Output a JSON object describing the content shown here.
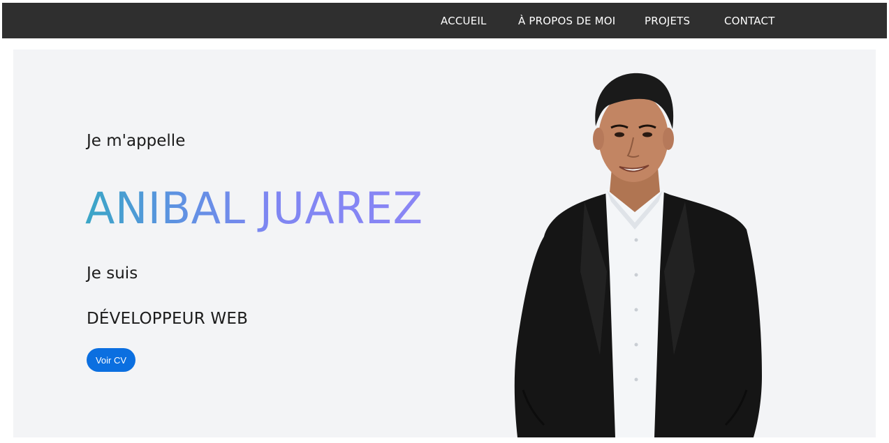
{
  "nav": {
    "items": [
      {
        "label": "ACCUEIL"
      },
      {
        "label": "À PROPOS DE MOI"
      },
      {
        "label": "PROJETS"
      },
      {
        "label": "CONTACT"
      }
    ]
  },
  "hero": {
    "greeting": "Je m'appelle",
    "name": "ANIBAL JUAREZ",
    "iam": "Je suis",
    "role": "DÉVELOPPEUR WEB",
    "cv_button_label": "Voir CV",
    "portrait_icon": "person-portrait-photo"
  },
  "colors": {
    "navbar_bg": "#2f2f2f",
    "hero_bg": "#f3f4f6",
    "name_gradient_start": "#3aa6c6",
    "name_gradient_end": "#8a85f5",
    "button_bg": "#0b6fe0"
  }
}
